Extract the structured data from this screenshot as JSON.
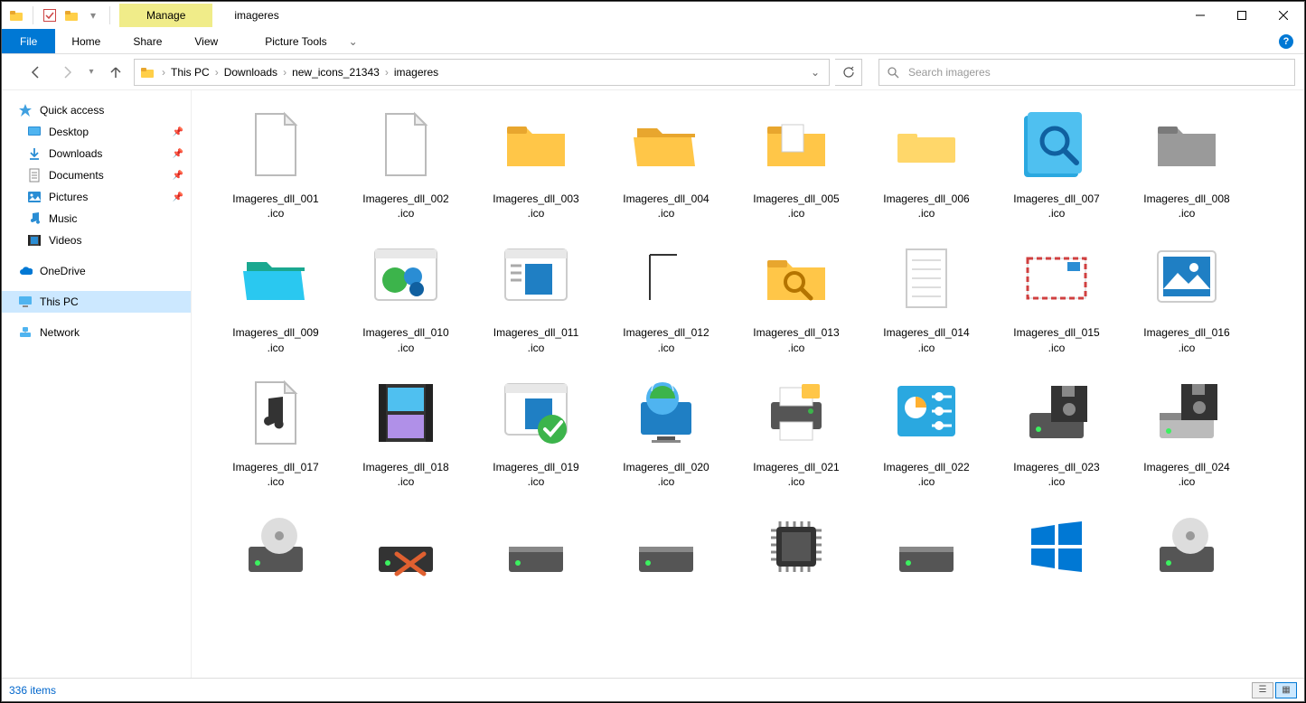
{
  "window_title": "imageres",
  "manage_tab": "Manage",
  "picture_tools": "Picture Tools",
  "file_tab": "File",
  "ribbon_tabs": [
    "Home",
    "Share",
    "View"
  ],
  "breadcrumbs": [
    "This PC",
    "Downloads",
    "new_icons_21343",
    "imageres"
  ],
  "search_placeholder": "Search imageres",
  "sidebar": {
    "quick_access": "Quick access",
    "desktop": "Desktop",
    "downloads": "Downloads",
    "documents": "Documents",
    "pictures": "Pictures",
    "music": "Music",
    "videos": "Videos",
    "onedrive": "OneDrive",
    "this_pc": "This PC",
    "network": "Network"
  },
  "files": [
    {
      "label": "Imageres_dll_001\n.ico",
      "icon": "blank-page"
    },
    {
      "label": "Imageres_dll_002\n.ico",
      "icon": "blank-page"
    },
    {
      "label": "Imageres_dll_003\n.ico",
      "icon": "folder-closed"
    },
    {
      "label": "Imageres_dll_004\n.ico",
      "icon": "folder-open"
    },
    {
      "label": "Imageres_dll_005\n.ico",
      "icon": "folder-docs"
    },
    {
      "label": "Imageres_dll_006\n.ico",
      "icon": "folder-flat"
    },
    {
      "label": "Imageres_dll_007\n.ico",
      "icon": "folder-search"
    },
    {
      "label": "Imageres_dll_008\n.ico",
      "icon": "folder-gray"
    },
    {
      "label": "Imageres_dll_009\n.ico",
      "icon": "folder-teal"
    },
    {
      "label": "Imageres_dll_010\n.ico",
      "icon": "network-globe"
    },
    {
      "label": "Imageres_dll_011\n.ico",
      "icon": "window-doc"
    },
    {
      "label": "Imageres_dll_012\n.ico",
      "icon": "blank-corner"
    },
    {
      "label": "Imageres_dll_013\n.ico",
      "icon": "folder-search-y"
    },
    {
      "label": "Imageres_dll_014\n.ico",
      "icon": "notepad"
    },
    {
      "label": "Imageres_dll_015\n.ico",
      "icon": "envelope"
    },
    {
      "label": "Imageres_dll_016\n.ico",
      "icon": "picture"
    },
    {
      "label": "Imageres_dll_017\n.ico",
      "icon": "music-note"
    },
    {
      "label": "Imageres_dll_018\n.ico",
      "icon": "film-strip"
    },
    {
      "label": "Imageres_dll_019\n.ico",
      "icon": "window-check"
    },
    {
      "label": "Imageres_dll_020\n.ico",
      "icon": "globe-monitor"
    },
    {
      "label": "Imageres_dll_021\n.ico",
      "icon": "printer"
    },
    {
      "label": "Imageres_dll_022\n.ico",
      "icon": "control-panel"
    },
    {
      "label": "Imageres_dll_023\n.ico",
      "icon": "floppy"
    },
    {
      "label": "Imageres_dll_024\n.ico",
      "icon": "floppy-drive"
    },
    {
      "label": "",
      "icon": "drive-disc"
    },
    {
      "label": "",
      "icon": "drive-x"
    },
    {
      "label": "",
      "icon": "drive"
    },
    {
      "label": "",
      "icon": "drive"
    },
    {
      "label": "",
      "icon": "cpu-chip"
    },
    {
      "label": "",
      "icon": "drive"
    },
    {
      "label": "",
      "icon": "windows-logo"
    },
    {
      "label": "",
      "icon": "drive-disc"
    }
  ],
  "status_text": "336 items"
}
